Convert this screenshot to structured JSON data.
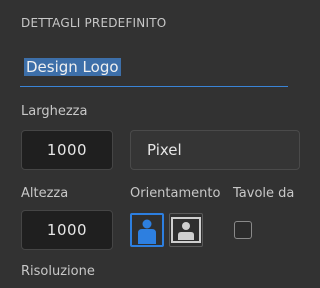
{
  "section": {
    "title": "DETTAGLI PREDEFINITO"
  },
  "preset_name": {
    "value": "Design Logo"
  },
  "width": {
    "label": "Larghezza",
    "value": "1000"
  },
  "unit": {
    "selected": "Pixel"
  },
  "height": {
    "label": "Altezza",
    "value": "1000"
  },
  "orientation": {
    "label": "Orientamento",
    "options": [
      "portrait-icon",
      "landscape-icon"
    ],
    "selected": "portrait"
  },
  "artboards": {
    "label": "Tavole da"
  },
  "resolution": {
    "label": "Risoluzione"
  },
  "colors": {
    "accent": "#2d7fe0",
    "selection": "#3d6fa9",
    "background": "#323232"
  }
}
